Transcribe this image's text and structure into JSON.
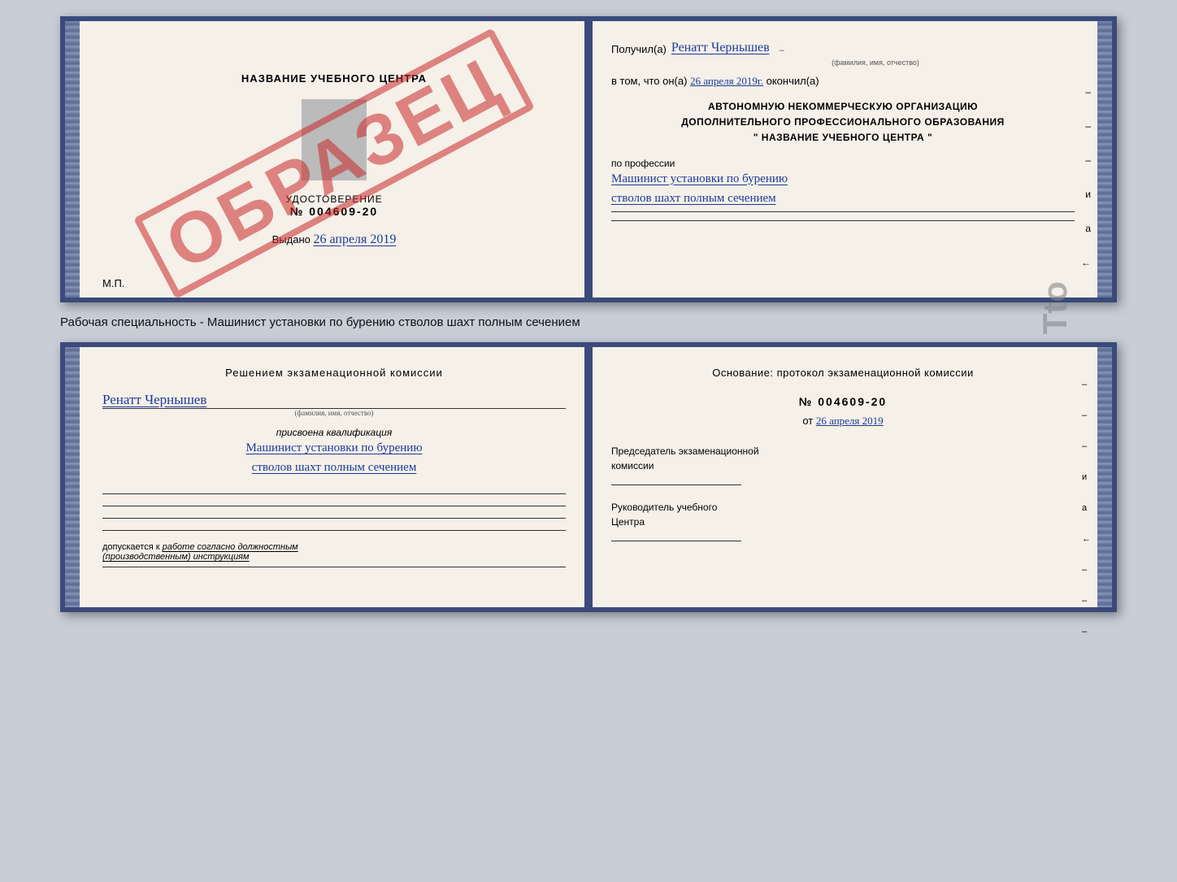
{
  "top_cert": {
    "left": {
      "title": "НАЗВАНИЕ УЧЕБНОГО ЦЕНТРА",
      "udostoverenie_label": "УДОСТОВЕРЕНИЕ",
      "number": "№ 004609-20",
      "vibdano": "Выдано",
      "vibdano_date": "26 апреля 2019",
      "mp": "М.П.",
      "stamp": "ОБРАЗЕЦ"
    },
    "right": {
      "poluchil": "Получил(а)",
      "fio": "Ренатт Чернышев",
      "fio_hint": "(фамилия, имя, отчество)",
      "vtom_prefix": "в том, что он(а)",
      "vtom_date": "26 апреля 2019г.",
      "okonchil": "окончил(а)",
      "org_line1": "АВТОНОМНУЮ НЕКОММЕРЧЕСКУЮ ОРГАНИЗАЦИЮ",
      "org_line2": "ДОПОЛНИТЕЛЬНОГО ПРОФЕССИОНАЛЬНОГО ОБРАЗОВАНИЯ",
      "org_line3": "\"  НАЗВАНИЕ УЧЕБНОГО ЦЕНТРА  \"",
      "po_professii": "по профессии",
      "profession_line1": "Машинист установки по бурению",
      "profession_line2": "стволов шахт полным сечением",
      "dash1": "–",
      "dash2": "–",
      "dash3": "–",
      "char_i": "и",
      "char_a": "а",
      "char_arrow": "←"
    }
  },
  "specialty_label": "Рабочая специальность - Машинист установки по бурению стволов шахт полным сечением",
  "bottom_cert": {
    "left": {
      "resheniem": "Решением  экзаменационной  комиссии",
      "fio": "Ренатт Чернышев",
      "fio_hint": "(фамилия, имя, отчество)",
      "prisvoena": "присвоена квалификация",
      "profession_line1": "Машинист установки по бурению",
      "profession_line2": "стволов шахт полным сечением",
      "dopuskaetsya": "допускается к",
      "rabota": "работе согласно должностным",
      "instruktsii": "(производственным) инструкциям"
    },
    "right": {
      "osnovanie": "Основание:  протокол  экзаменационной  комиссии",
      "number": "№  004609-20",
      "ot_prefix": "от",
      "date": "26 апреля 2019",
      "predsedatel_line1": "Председатель экзаменационной",
      "predsedatel_line2": "комиссии",
      "rukovoditel_line1": "Руководитель учебного",
      "rukovoditel_line2": "Центра",
      "dash1": "–",
      "dash2": "–",
      "dash3": "–",
      "char_i": "и",
      "char_a": "а",
      "char_arrow": "←"
    }
  },
  "side_text": "Tto"
}
